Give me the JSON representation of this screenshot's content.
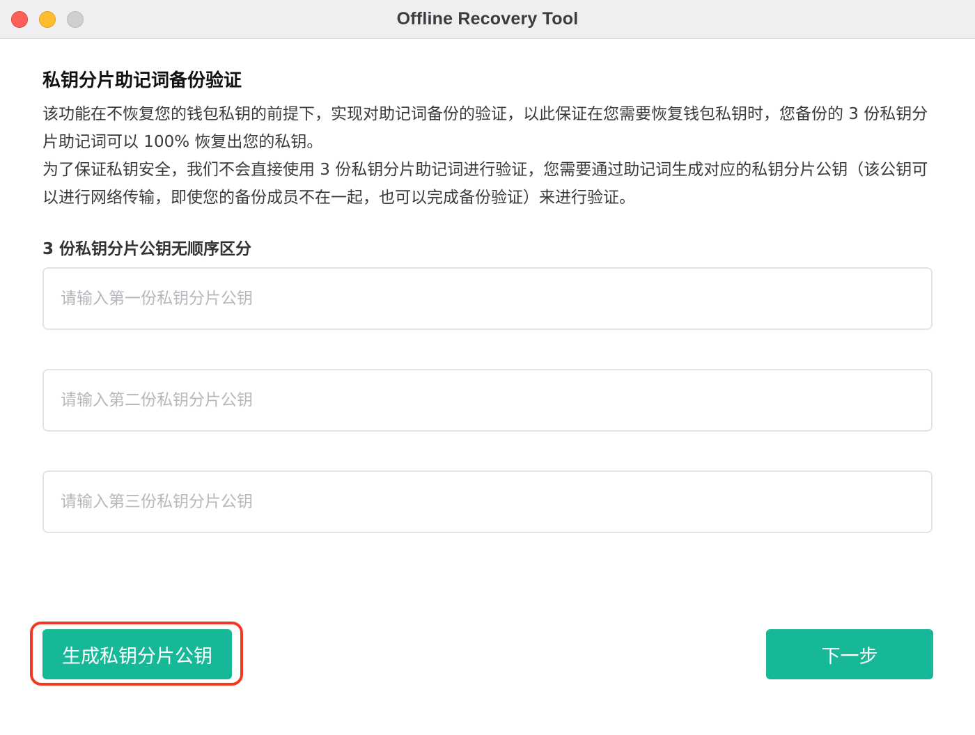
{
  "window": {
    "title": "Offline Recovery Tool"
  },
  "main": {
    "heading": "私钥分片助记词备份验证",
    "paragraph1": "该功能在不恢复您的钱包私钥的前提下，实现对助记词备份的验证，以此保证在您需要恢复钱包私钥时，您备份的 3 份私钥分片助记词可以 100% 恢复出您的私钥。",
    "paragraph2": "为了保证私钥安全，我们不会直接使用 3 份私钥分片助记词进行验证，您需要通过助记词生成对应的私钥分片公钥（该公钥可以进行网络传输，即使您的备份成员不在一起，也可以完成备份验证）来进行验证。",
    "fields_label": "3 份私钥分片公钥无顺序区分",
    "fields": [
      {
        "value": "",
        "placeholder": "请输入第一份私钥分片公钥"
      },
      {
        "value": "",
        "placeholder": "请输入第二份私钥分片公钥"
      },
      {
        "value": "",
        "placeholder": "请输入第三份私钥分片公钥"
      }
    ]
  },
  "footer": {
    "generate_label": "生成私钥分片公钥",
    "next_label": "下一步"
  },
  "colors": {
    "accent": "#16b898",
    "highlight": "#f03a24",
    "close": "#fe5f57",
    "minimize": "#febc2e",
    "zoom": "#cfcfd1"
  }
}
